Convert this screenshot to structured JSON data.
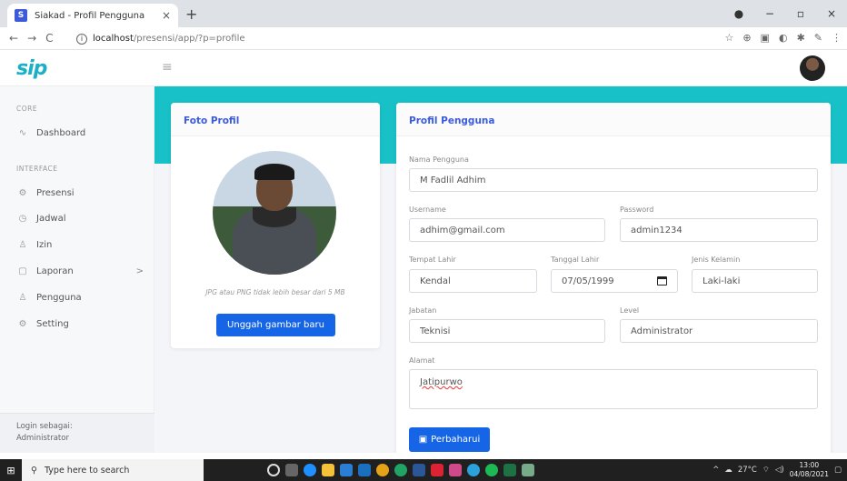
{
  "browser": {
    "tab_title": "Siakad - Profil Pengguna",
    "tab_favicon": "S",
    "tab_close": "×",
    "new_tab": "+",
    "url_host": "localhost",
    "url_path": "/presensi/app/?p=profile",
    "window_controls": [
      "●",
      "−",
      "▫",
      "×"
    ]
  },
  "topnav": {
    "logo": "sip",
    "menu_icon": "≡"
  },
  "sidebar": {
    "sections": [
      "CORE",
      "INTERFACE"
    ],
    "items": [
      {
        "label": "Dashboard",
        "icon": "∿"
      },
      {
        "label": "Presensi",
        "icon": "⚙"
      },
      {
        "label": "Jadwal",
        "icon": "◷"
      },
      {
        "label": "Izin",
        "icon": "♙"
      },
      {
        "label": "Laporan",
        "icon": "▢",
        "chevron": ">"
      },
      {
        "label": "Pengguna",
        "icon": "♙"
      },
      {
        "label": "Setting",
        "icon": "⚙"
      }
    ],
    "footer_label": "Login sebagai:",
    "footer_role": "Administrator"
  },
  "photo_card": {
    "title": "Foto Profil",
    "hint": "JPG atau PNG tidak lebih besar dari 5 MB",
    "upload_button": "Unggah gambar baru"
  },
  "profile_card": {
    "title": "Profil Pengguna",
    "fields": {
      "nama_label": "Nama Pengguna",
      "nama": "M Fadlil Adhim",
      "username_label": "Username",
      "username": "adhim@gmail.com",
      "password_label": "Password",
      "password": "admin1234",
      "tempat_label": "Tempat Lahir",
      "tempat": "Kendal",
      "tanggal_label": "Tanggal Lahir",
      "tanggal": "07/05/1999",
      "jk_label": "Jenis Kelamin",
      "jk": "Laki-laki",
      "jabatan_label": "Jabatan",
      "jabatan": "Teknisi",
      "level_label": "Level",
      "level": "Administrator",
      "alamat_label": "Alamat",
      "alamat": "Jatipurwo"
    },
    "submit_button": "Perbaharui"
  },
  "taskbar": {
    "search_placeholder": "Type here to search",
    "temperature": "27°C",
    "time": "13:00",
    "date": "04/08/2021"
  }
}
